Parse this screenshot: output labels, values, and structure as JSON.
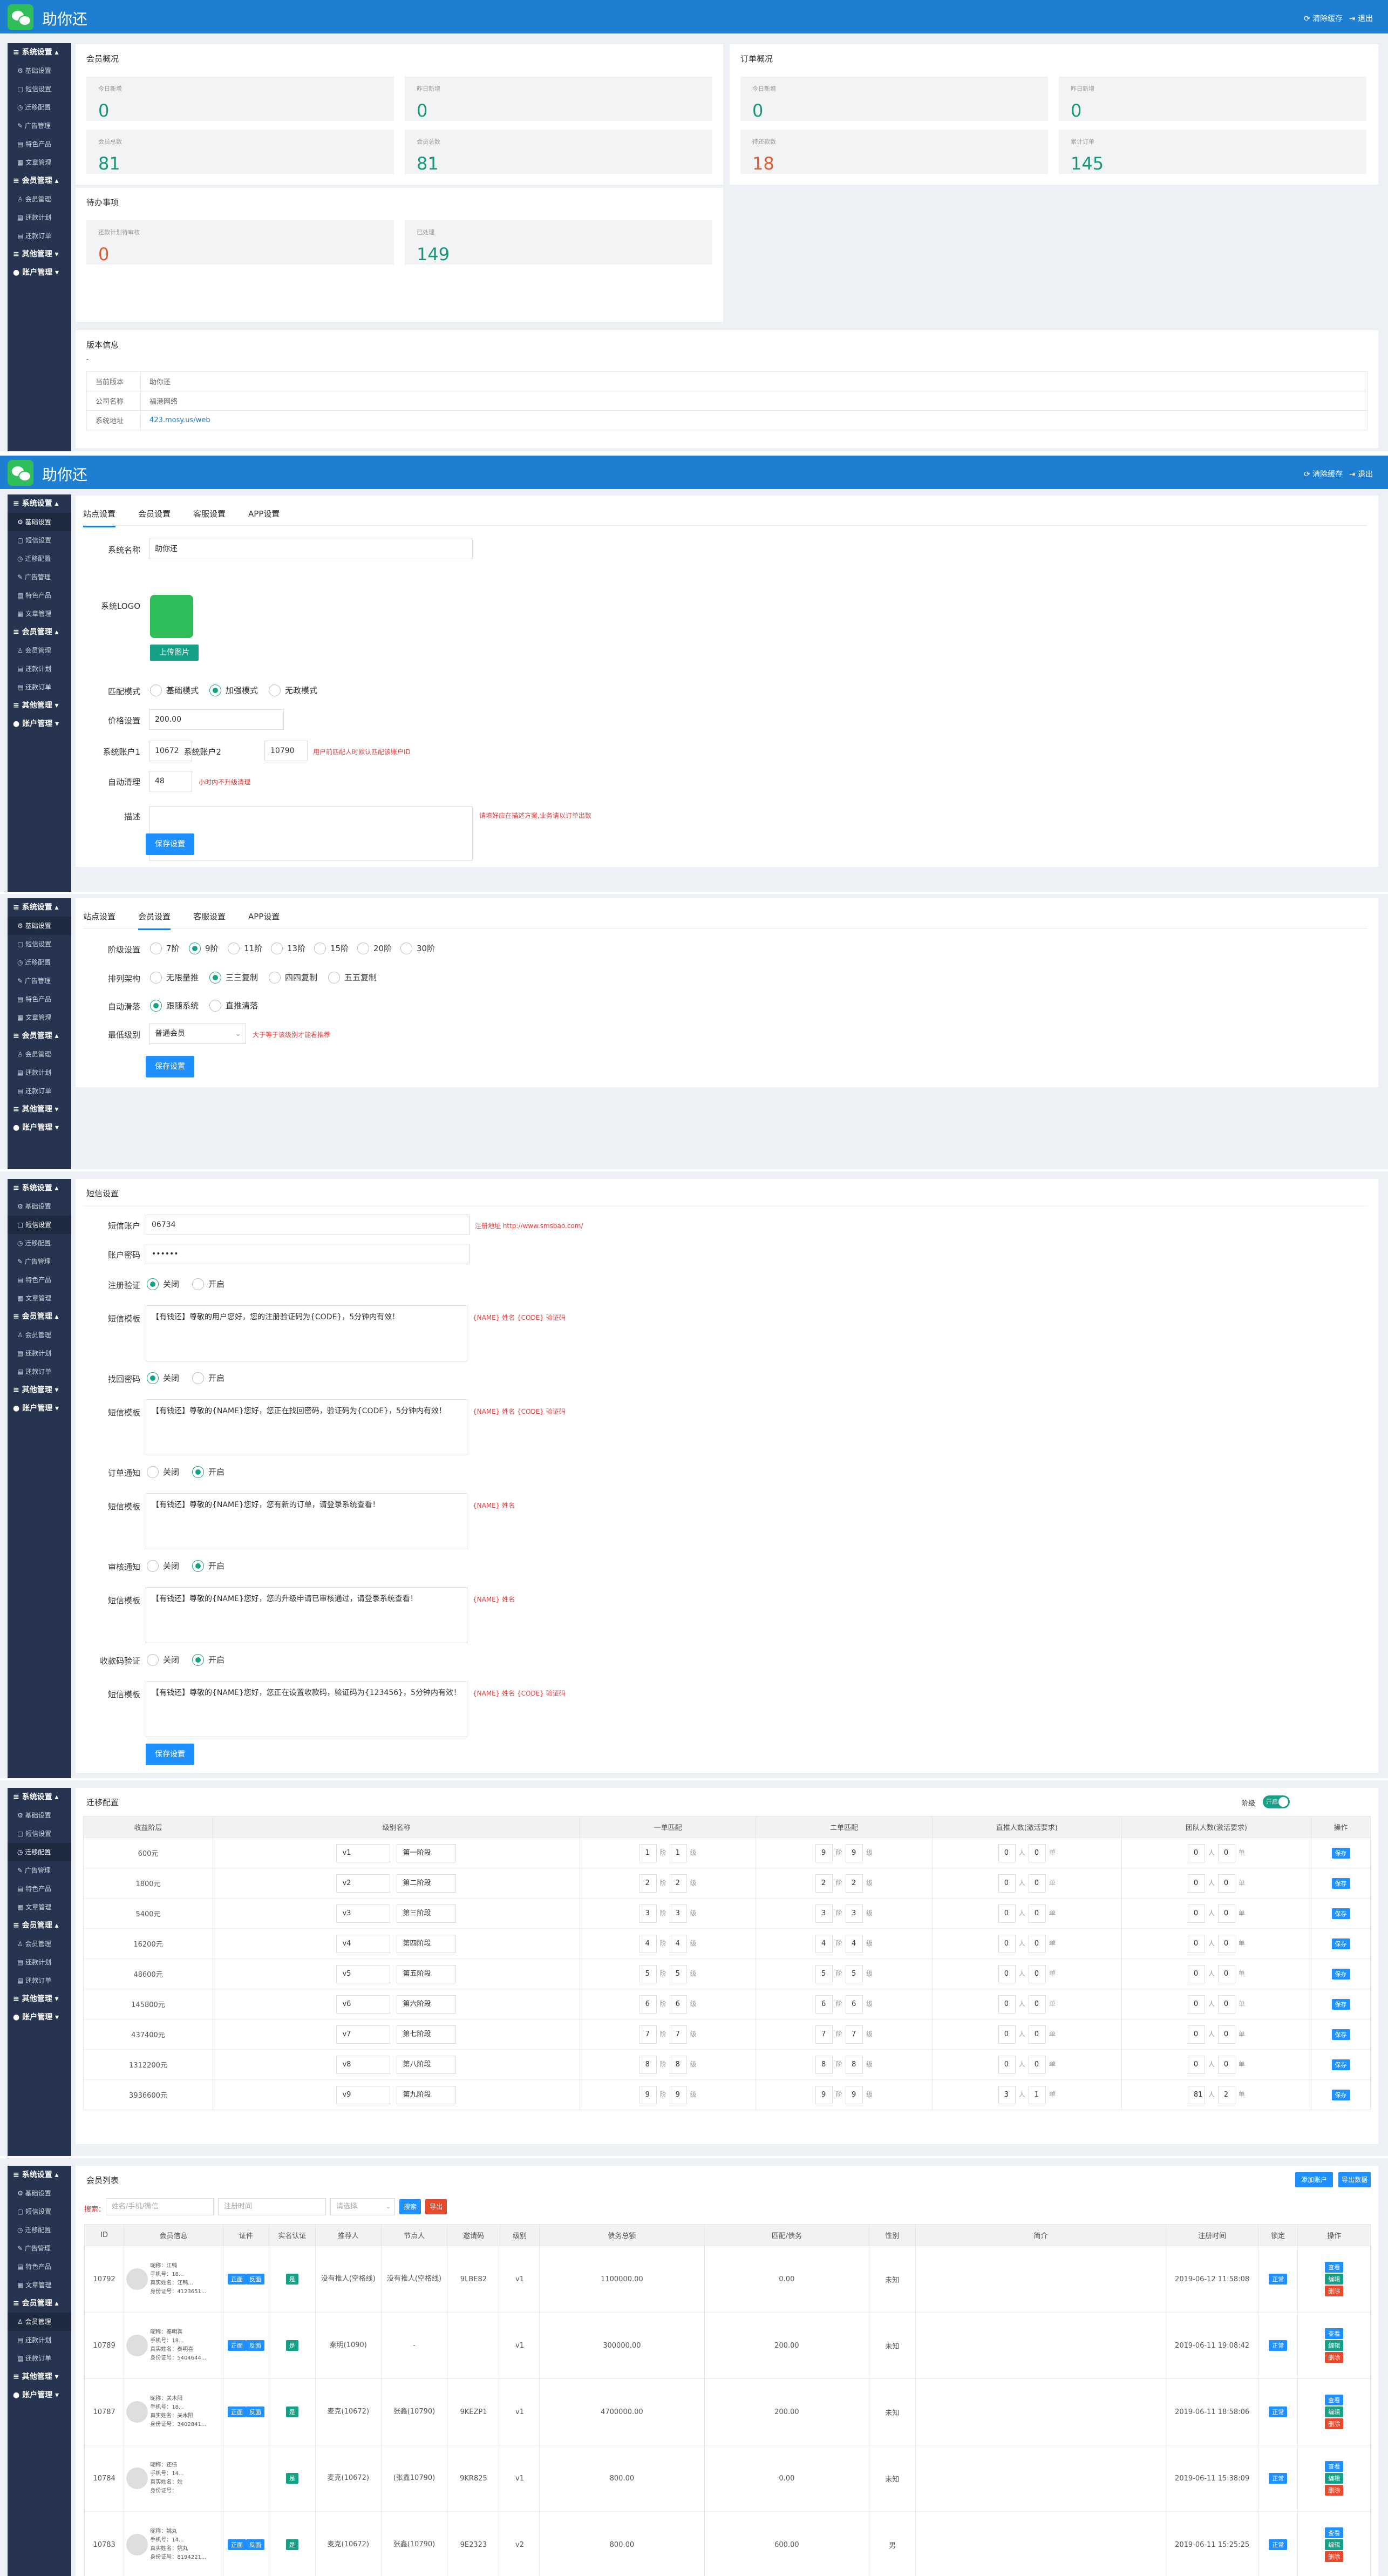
{
  "app": {
    "title": "助你还",
    "clear_cache": "清除缓存",
    "logout": "退出"
  },
  "side": {
    "sys": "系统设置",
    "base": "基础设置",
    "sms": "短信设置",
    "mark": "迁移配置",
    "ad": "广告管理",
    "prod": "特色产品",
    "article": "文章管理",
    "member": "会员管理",
    "member_mgr": "会员管理",
    "plan": "还款计划",
    "order": "还款订单",
    "other": "其他管理",
    "acct": "账户管理"
  },
  "dash": {
    "member_overview": "会员概况",
    "today_new": "今日新增",
    "today_new_v": "0",
    "yesterday_new": "昨日新增",
    "yesterday_new_v": "0",
    "total_members": "会员总数",
    "total_members_v": "81",
    "total_certified": "会员总数",
    "total_certified_v": "81",
    "order_overview": "订单概况",
    "today_orders": "今日新增",
    "today_orders_v": "0",
    "yesterday_orders": "昨日新增",
    "yesterday_orders_v": "0",
    "pending_orders": "待还款数",
    "pending_orders_v": "18",
    "total_orders": "累计订单",
    "total_orders_v": "145",
    "todo": "待办事项",
    "plan_review": "还款计划待审核",
    "plan_review_v": "0",
    "done": "已处理",
    "done_v": "149",
    "version_info": "版本信息",
    "dash_char": "-",
    "row1_k": "当前版本",
    "row1_v": "助你还",
    "row2_k": "公司名称",
    "row2_v": "福港网络",
    "row3_k": "系统地址",
    "row3_v": "423.mosy.us/web"
  },
  "site": {
    "tab1": "站点设置",
    "tab2": "会员设置",
    "tab3": "客服设置",
    "tab4": "APP设置",
    "name_label": "系统名称",
    "name_val": "助你还",
    "logo_label": "系统LOGO",
    "upload": "上传图片",
    "match_label": "匹配模式",
    "match1": "基础模式",
    "match2": "加强模式",
    "match3": "无政模式",
    "price_label": "价格设置",
    "price_val": "200.00",
    "acct1_label": "系统账户1",
    "acct1_val": "10672",
    "acct2_label": "系统账户2",
    "acct2_val": "10790",
    "acct_hint": "用户前匹配人时默认匹配该账户ID",
    "auto_label": "自动清理",
    "auto_val": "48",
    "auto_hint": "小时内不升级清理",
    "desc_label": "描述",
    "desc_hint": "请填好应在描述方案,业务请以订单出数",
    "save": "保存设置"
  },
  "member_set": {
    "level_label": "阶级设置",
    "l1": "7阶",
    "l2": "9阶",
    "l3": "11阶",
    "l4": "13阶",
    "l5": "15阶",
    "l6": "20阶",
    "l7": "30阶",
    "rank_label": "排列架构",
    "r1": "无限量推",
    "r2": "三三复制",
    "r3": "四四复制",
    "r4": "五五复制",
    "auto_label": "自动滑落",
    "a1": "跟随系统",
    "a2": "直推清落",
    "min_label": "最低级别",
    "min_val": "普通会员",
    "min_hint": "大于等于该级别才能看推荐",
    "save": "保存设置"
  },
  "sms": {
    "title": "短信设置",
    "acct_label": "短信账户",
    "acct_val": "06734",
    "acct_hint": "注册地址 http://www.smsbao.com/",
    "pwd_label": "账户密码",
    "pwd_val": "••••••",
    "reg_label": "注册验证",
    "off": "关闭",
    "on": "开启",
    "tpl_label": "短信模板",
    "tpl1": "【有钱还】尊敬的用户您好，您的注册验证码为{CODE}，5分钟内有效！",
    "tpl1_hint": "{NAME} 姓名 {CODE} 验证码",
    "find_label": "找回密码",
    "tpl2": "【有钱还】尊敬的{NAME}您好，您正在找回密码，验证码为{CODE}，5分钟内有效！",
    "tpl2_hint": "{NAME} 姓名 {CODE} 验证码",
    "order_label": "订单通知",
    "tpl3": "【有钱还】尊敬的{NAME}您好，您有新的订单，请登录系统查看！",
    "tpl3_hint": "{NAME} 姓名",
    "audit_label": "审核通知",
    "tpl4": "【有钱还】尊敬的{NAME}您好，您的升级申请已审核通过，请登录系统查看！",
    "tpl4_hint": "{NAME} 姓名",
    "pay_label": "收款码验证",
    "tpl5": "【有钱还】尊敬的{NAME}您好，您正在设置收款码，验证码为{123456}，5分钟内有效！",
    "tpl5_hint": "{NAME} 姓名 {CODE} 验证码",
    "save": "保存设置"
  },
  "levels": {
    "title": "迁移配置",
    "switch_label": "阶级",
    "switch_state": "开启",
    "headers": [
      "收益阶层",
      "级别名称",
      "一单匹配",
      "二单匹配",
      "直推人数(激活要求)",
      "团队人数(激活要求)",
      "操作"
    ],
    "unit_step": "阶",
    "unit_rank": "级",
    "unit_person": "人",
    "unit_dan": "单",
    "save": "保存",
    "rows": [
      {
        "amount": "600元",
        "code": "v1",
        "name": "第一阶段",
        "m1a": "1",
        "m1b": "1",
        "m2a": "9",
        "m2b": "9",
        "d1": "0",
        "d2": "0",
        "t1": "0",
        "t2": "0"
      },
      {
        "amount": "1800元",
        "code": "v2",
        "name": "第二阶段",
        "m1a": "2",
        "m1b": "2",
        "m2a": "2",
        "m2b": "2",
        "d1": "0",
        "d2": "0",
        "t1": "0",
        "t2": "0"
      },
      {
        "amount": "5400元",
        "code": "v3",
        "name": "第三阶段",
        "m1a": "3",
        "m1b": "3",
        "m2a": "3",
        "m2b": "3",
        "d1": "0",
        "d2": "0",
        "t1": "0",
        "t2": "0"
      },
      {
        "amount": "16200元",
        "code": "v4",
        "name": "第四阶段",
        "m1a": "4",
        "m1b": "4",
        "m2a": "4",
        "m2b": "4",
        "d1": "0",
        "d2": "0",
        "t1": "0",
        "t2": "0"
      },
      {
        "amount": "48600元",
        "code": "v5",
        "name": "第五阶段",
        "m1a": "5",
        "m1b": "5",
        "m2a": "5",
        "m2b": "5",
        "d1": "0",
        "d2": "0",
        "t1": "0",
        "t2": "0"
      },
      {
        "amount": "145800元",
        "code": "v6",
        "name": "第六阶段",
        "m1a": "6",
        "m1b": "6",
        "m2a": "6",
        "m2b": "6",
        "d1": "0",
        "d2": "0",
        "t1": "0",
        "t2": "0"
      },
      {
        "amount": "437400元",
        "code": "v7",
        "name": "第七阶段",
        "m1a": "7",
        "m1b": "7",
        "m2a": "7",
        "m2b": "7",
        "d1": "0",
        "d2": "0",
        "t1": "0",
        "t2": "0"
      },
      {
        "amount": "1312200元",
        "code": "v8",
        "name": "第八阶段",
        "m1a": "8",
        "m1b": "8",
        "m2a": "8",
        "m2b": "8",
        "d1": "0",
        "d2": "0",
        "t1": "0",
        "t2": "0"
      },
      {
        "amount": "3936600元",
        "code": "v9",
        "name": "第九阶段",
        "m1a": "9",
        "m1b": "9",
        "m2a": "9",
        "m2b": "9",
        "d1": "3",
        "d2": "1",
        "t1": "81",
        "t2": "2"
      }
    ]
  },
  "members": {
    "title": "会员列表",
    "add_btn": "添加账户",
    "export_btn": "导出数据",
    "search_label": "搜索：",
    "search_ph": "姓名/手机/微信",
    "date_ph": "注册时间",
    "select_ph": "请选择",
    "search_btn": "搜索",
    "reset_btn": "导出",
    "headers": [
      "ID",
      "会员信息",
      "证件",
      "实名认证",
      "推荐人",
      "节点人",
      "邀请码",
      "级别",
      "债务总额",
      "匹配/债务",
      "性别",
      "简介",
      "注册时间",
      "锁定",
      "操作"
    ],
    "nick": "昵称：",
    "phone": "手机号：",
    "bank": "真实姓名：",
    "idno": "身份证号：",
    "tag_ok": "正面",
    "tag_back": "反面",
    "real_ok": "是",
    "lock": "正常",
    "op_view": "查看",
    "op_edit": "编辑",
    "op_del": "删除",
    "rows": [
      {
        "id": "10792",
        "nick": "江鸭",
        "phone": "18...",
        "bank": "江鸭...",
        "idno": "4123651...",
        "ref": "没有推人(空格线)",
        "node": "没有推人(空格线)",
        "code": "9LBE82",
        "lvl": "v1",
        "debt": "1100000.00",
        "match": "0.00",
        "sex": "未知",
        "time": "2019-06-12 11:58:08"
      },
      {
        "id": "10789",
        "nick": "秦明喜",
        "phone": "18...",
        "bank": "秦明喜",
        "idno": "5404644...",
        "ref": "秦明(1090)",
        "node": "-",
        "code": "",
        "lvl": "v1",
        "debt": "300000.00",
        "match": "200.00",
        "sex": "未知",
        "time": "2019-06-11 19:08:42"
      },
      {
        "id": "10787",
        "nick": "关木阳",
        "phone": "18...",
        "bank": "关木阳",
        "idno": "3402841...",
        "ref": "麦克(10672)",
        "node": "张鑫(10790)",
        "code": "9KEZP1",
        "lvl": "v1",
        "debt": "4700000.00",
        "match": "200.00",
        "sex": "未知",
        "time": "2019-06-11 18:58:06"
      },
      {
        "id": "10784",
        "nick": "还债",
        "phone": "14...",
        "bank": "姓",
        "idno": "",
        "ref": "麦克(10672)",
        "node": "(张鑫10790)",
        "code": "9KR825",
        "lvl": "v1",
        "debt": "800.00",
        "match": "0.00",
        "sex": "未知",
        "time": "2019-06-11 15:38:09"
      },
      {
        "id": "10783",
        "nick": "姚丸",
        "phone": "14...",
        "bank": "姚丸",
        "idno": "8194221...",
        "ref": "麦克(10672)",
        "node": "张鑫(10790)",
        "code": "9E2323",
        "lvl": "v2",
        "debt": "800.00",
        "match": "600.00",
        "sex": "男",
        "time": "2019-06-11 15:25:25"
      }
    ]
  }
}
